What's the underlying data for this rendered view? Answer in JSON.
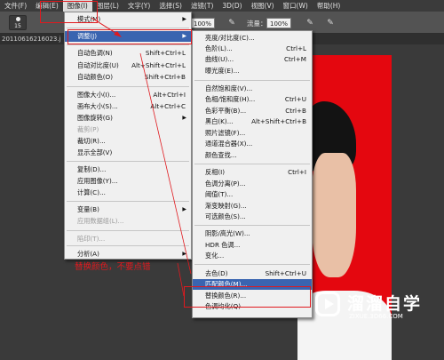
{
  "menubar": {
    "items": [
      "文件(F)",
      "编辑(E)",
      "图像(I)",
      "图层(L)",
      "文字(Y)",
      "选择(S)",
      "滤镜(T)",
      "3D(D)",
      "视图(V)",
      "窗口(W)",
      "帮助(H)"
    ]
  },
  "options_bar": {
    "brush_size": "15",
    "opacity_value": "100%",
    "flow_label": "流量：",
    "flow_value": "100%"
  },
  "document_tab": "20110616216023.j",
  "image_menu": [
    {
      "label": "模式(M)",
      "submenu": true
    },
    {
      "label": "调整(J)",
      "submenu": true,
      "highlighted": true
    },
    {
      "label": "自动色调(N)",
      "shortcut": "Shift+Ctrl+L"
    },
    {
      "label": "自动对比度(U)",
      "shortcut": "Alt+Shift+Ctrl+L"
    },
    {
      "label": "自动颜色(O)",
      "shortcut": "Shift+Ctrl+B"
    },
    {
      "label": "图像大小(I)...",
      "shortcut": "Alt+Ctrl+I"
    },
    {
      "label": "画布大小(S)...",
      "shortcut": "Alt+Ctrl+C"
    },
    {
      "label": "图像旋转(G)",
      "submenu": true
    },
    {
      "label": "裁剪(P)",
      "disabled": true
    },
    {
      "label": "裁切(R)..."
    },
    {
      "label": "显示全部(V)"
    },
    {
      "label": "复制(D)..."
    },
    {
      "label": "应用图像(Y)..."
    },
    {
      "label": "计算(C)..."
    },
    {
      "label": "变量(B)",
      "submenu": true
    },
    {
      "label": "应用数据组(L)...",
      "disabled": true
    },
    {
      "label": "陷印(T)...",
      "disabled": true
    },
    {
      "label": "分析(A)",
      "submenu": true
    }
  ],
  "adjust_menu": [
    {
      "label": "亮度/对比度(C)..."
    },
    {
      "label": "色阶(L)...",
      "shortcut": "Ctrl+L"
    },
    {
      "label": "曲线(U)...",
      "shortcut": "Ctrl+M"
    },
    {
      "label": "曝光度(E)..."
    },
    {
      "label": "自然饱和度(V)..."
    },
    {
      "label": "色相/饱和度(H)...",
      "shortcut": "Ctrl+U"
    },
    {
      "label": "色彩平衡(B)...",
      "shortcut": "Ctrl+B"
    },
    {
      "label": "黑白(K)...",
      "shortcut": "Alt+Shift+Ctrl+B"
    },
    {
      "label": "照片滤镜(F)..."
    },
    {
      "label": "通道混合器(X)..."
    },
    {
      "label": "颜色查找..."
    },
    {
      "label": "反相(I)",
      "shortcut": "Ctrl+I"
    },
    {
      "label": "色调分离(P)..."
    },
    {
      "label": "阈值(T)..."
    },
    {
      "label": "渐变映射(G)..."
    },
    {
      "label": "可选颜色(S)..."
    },
    {
      "label": "阴影/高光(W)..."
    },
    {
      "label": "HDR 色调..."
    },
    {
      "label": "变化..."
    },
    {
      "label": "去色(D)",
      "shortcut": "Shift+Ctrl+U"
    },
    {
      "label": "匹配颜色(M)...",
      "highlighted": true
    },
    {
      "label": "替换颜色(R)..."
    },
    {
      "label": "色调均化(Q)"
    }
  ],
  "annotation": "替换颜色，不要点错",
  "watermark": {
    "title": "溜溜自学",
    "url": "ZIXUE.3D66.COM"
  },
  "colors": {
    "accent_red": "#e0191e",
    "highlight": "#3a64b0",
    "photo_bg": "#e4070f"
  }
}
